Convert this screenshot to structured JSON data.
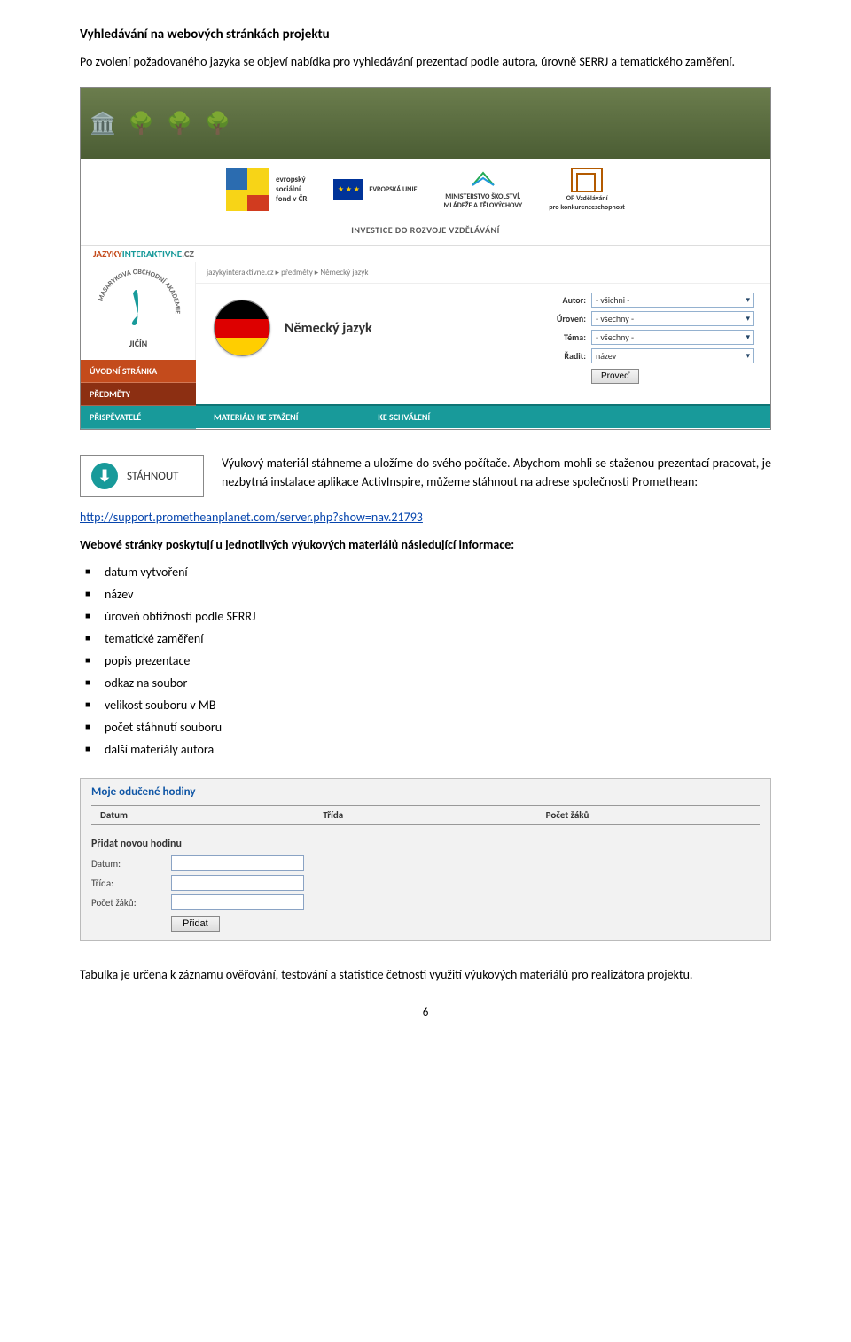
{
  "page": {
    "title": "Vyhledávání na webových stránkách projektu",
    "intro": "Po zvolení požadovaného jazyka se objeví nabídka pro vyhledávání prezentací podle autora, úrovně SERRJ a tematického zaměření.",
    "number": "6"
  },
  "screenshot1": {
    "brand": "JAZYKYINTERAKTIVNE.CZ",
    "logos": {
      "esf": "evropský\nsociální\nfond v ČR",
      "eu_label": "EVROPSKÁ UNIE",
      "msmt": "MINISTERSTVO ŠKOLSTVÍ,\nMLÁDEŽE A TĚLOVÝCHOVY",
      "opvk": "OP Vzdělávání\npro konkurenceschopnost"
    },
    "invest": "INVESTICE DO ROZVOJE VZDĚLÁVÁNÍ",
    "breadcrumb": "jazykyinteraktivne.cz  ▸  předměty  ▸  Německý jazyk",
    "school": "MASARYKOVA OBCHODNÍ AKADEMIE JIČÍN",
    "nav": {
      "home": "ÚVODNÍ STRÁNKA",
      "subjects": "PŘEDMĚTY",
      "contributors": "PŘISPĚVATELÉ"
    },
    "subject": "Německý jazyk",
    "filters": {
      "autor_label": "Autor:",
      "autor_value": "- všichni -",
      "uroven_label": "Úroveň:",
      "uroven_value": "- všechny -",
      "tema_label": "Téma:",
      "tema_value": "- všechny -",
      "radit_label": "Řadit:",
      "radit_value": "název",
      "submit": "Proveď"
    },
    "tabs": {
      "download": "MATERIÁLY KE STAŽENÍ",
      "approve": "KE SCHVÁLENÍ"
    }
  },
  "download": {
    "button_label": "STÁHNOUT",
    "paragraph": "Výukový materiál stáhneme a uložíme do svého počítače. Abychom mohli se staženou prezentací pracovat, je nezbytná instalace aplikace ActivInspire, můžeme stáhnout na adrese společnosti Promethean:",
    "link": "http://support.prometheanplanet.com/server.php?show=nav.21793"
  },
  "after_link": "Webové stránky poskytují u jednotlivých výukových materiálů následující informace:",
  "bullets": [
    "datum vytvoření",
    "název",
    "úroveň obtížnosti podle SERRJ",
    "tematické zaměření",
    "popis prezentace",
    "odkaz na soubor",
    "velikost souboru v MB",
    "počet stáhnutí souboru",
    "další materiály autora"
  ],
  "screenshot2": {
    "heading": "Moje odučené hodiny",
    "cols": {
      "date": "Datum",
      "class": "Třída",
      "count": "Počet žáků"
    },
    "sub": "Přidat novou hodinu",
    "form": {
      "date": "Datum:",
      "class": "Třída:",
      "count": "Počet žáků:",
      "submit": "Přidat"
    }
  },
  "closing": "Tabulka je určena k záznamu ověřování, testování a statistice četnosti využití výukových materiálů pro realizátora projektu."
}
